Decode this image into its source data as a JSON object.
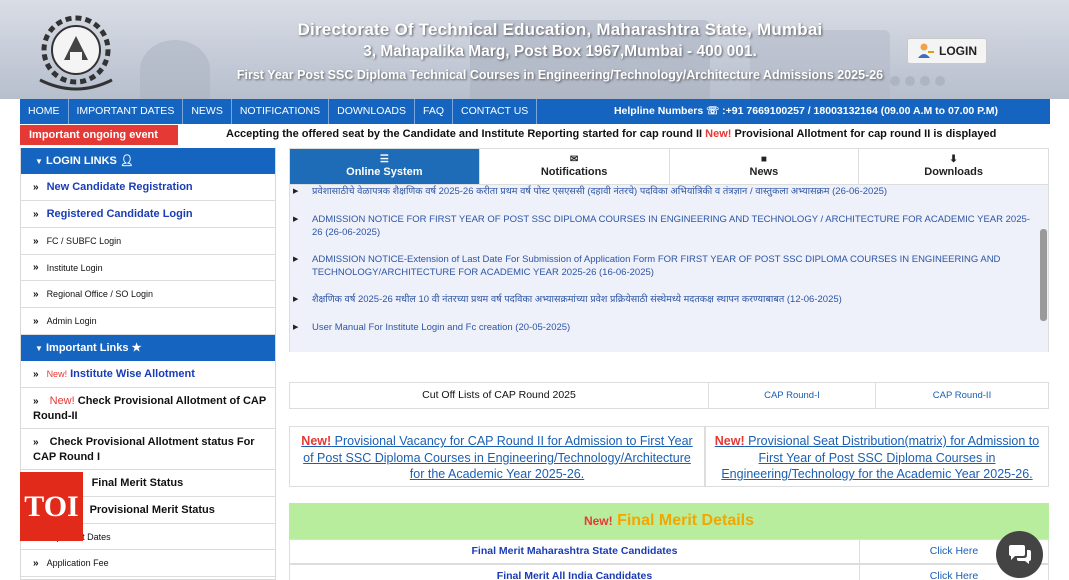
{
  "header": {
    "title_line1": "Directorate Of Technical Education, Maharashtra State, Mumbai",
    "title_line2": "3, Mahapalika Marg, Post Box 1967,Mumbai - 400 001.",
    "subtitle": "First Year Post SSC Diploma Technical Courses in Engineering/Technology/Architecture Admissions 2025-26",
    "login_label": "LOGIN",
    "logo_icon": "dte-emblem-icon"
  },
  "nav": {
    "items": [
      "HOME",
      "IMPORTANT DATES",
      "NEWS",
      "NOTIFICATIONS",
      "DOWNLOADS",
      "FAQ",
      "CONTACT US"
    ],
    "helpline": "Helpline Numbers ☏ :+91 7669100257 / 18003132164   (09.00 A.M to 07.00 P.M)"
  },
  "ticker": {
    "badge": "Important ongoing event",
    "text_part1": "Accepting the offered seat by the Candidate and Institute Reporting started for cap round II ",
    "new_label": "New!",
    "text_part2": " Provisional Allotment for cap round II is displayed"
  },
  "sidebar": {
    "login_links_heading": "LOGIN LINKS",
    "login_links": [
      "New Candidate Registration",
      "Registered Candidate Login",
      "FC / SUBFC Login",
      "Institute Login",
      "Regional Office / SO Login",
      "Admin Login"
    ],
    "important_links_heading": "Important Links",
    "important_links": [
      {
        "new": "New!",
        "label": "Institute Wise Allotment"
      },
      {
        "new": "New!",
        "label": "Check Provisional Allotment of CAP Round-II"
      },
      {
        "new": "",
        "label": "Check Provisional Allotment status For CAP Round I"
      },
      {
        "new": "",
        "label": "Final Merit Status"
      },
      {
        "new": "",
        "label": "Provisional Merit Status"
      },
      {
        "new": "",
        "label": "Important Dates"
      },
      {
        "new": "",
        "label": "Application Fee"
      }
    ]
  },
  "tabs": [
    {
      "label": "Online System",
      "icon": "document-icon"
    },
    {
      "label": "Notifications",
      "icon": "envelope-icon"
    },
    {
      "label": "News",
      "icon": "file-icon"
    },
    {
      "label": "Downloads",
      "icon": "download-icon"
    }
  ],
  "notices": [
    "प्रवेशासाठीचे वेळापत्रक शैक्षणिक वर्ष 2025-26 करीता प्रथम वर्ष पोस्ट एसएससी (दहावी नंतरचे) पदविका अभियांत्रिकी व तंत्रज्ञान / वास्तुकला अभ्यासक्रम (26-06-2025)",
    "ADMISSION NOTICE FOR FIRST YEAR OF POST SSC DIPLOMA COURSES IN ENGINEERING AND TECHNOLOGY / ARCHITECTURE FOR ACADEMIC YEAR 2025-26 (26-06-2025)",
    "ADMISSION NOTICE-Extension of Last Date For Submission of Application Form FOR FIRST YEAR OF POST SSC DIPLOMA COURSES IN ENGINEERING AND TECHNOLOGY/ARCHITECTURE FOR ACADEMIC YEAR 2025-26 (16-06-2025)",
    "शैक्षणिक वर्ष 2025-26 मधील 10 वी नंतरच्या प्रथम वर्ष पदविका अभ्यासक्रमांच्या प्रवेश प्रक्रियेसाठी संस्थेमध्ये मदतकक्ष स्थापन करण्याबाबत (12-06-2025)",
    "User Manual For Institute Login and Fc creation (20-05-2025)"
  ],
  "cutoff": {
    "label": "Cut Off Lists of CAP Round 2025",
    "round1": "CAP Round-I",
    "round2": "CAP Round-II"
  },
  "provisional": {
    "left_new": "New!",
    "left_text": " Provisional Vacancy for CAP Round II for Admission to First Year of Post SSC Diploma Courses in Engineering/Technology/Architecture for the Academic Year 2025-26.",
    "right_new": "New!",
    "right_text": " Provisional Seat Distribution(matrix) for Admission to First Year of Post SSC Diploma Courses in Engineering/Technology for the Academic Year 2025-26."
  },
  "final_merit": {
    "new_label": "New!",
    "heading": " Final Merit Details",
    "rows": [
      {
        "label": "Final Merit Maharashtra State Candidates",
        "action": "Click Here"
      },
      {
        "label": "Final Merit All India Candidates",
        "action": "Click Here"
      }
    ]
  },
  "overlay": {
    "toi_logo": "TOI",
    "chat_icon": "chat-bubbles-icon"
  },
  "colors": {
    "primary_blue": "#1565c0",
    "alert_red": "#e53935",
    "merit_green": "#b9ed9e",
    "merit_orange": "#f2a600"
  }
}
